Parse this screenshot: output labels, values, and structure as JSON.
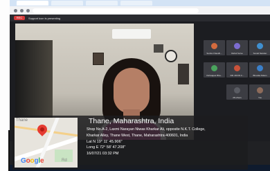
{
  "browser": {
    "tabs": [
      "",
      "",
      "",
      ""
    ],
    "meet_status": "Support icon is presenting",
    "rec_label": "REC"
  },
  "speaker": {
    "name_tag": "Dr.Pritty Bhatia"
  },
  "participants": [
    {
      "name": "Sunita Chaudh...",
      "color": "#d36b3e"
    },
    {
      "name": "Rahul Surve",
      "color": "#7c6cd0"
    },
    {
      "name": "Sonali Nandan",
      "color": "#3f8fd0"
    },
    {
      "name": "Vishwajeet Bha...",
      "color": "#4aa35d"
    },
    {
      "name": "DR. ARUN C...",
      "color": "#c9523a"
    },
    {
      "name": "Bhuvika Nikam",
      "color": "#3a7fc9"
    },
    {
      "name": "28 others",
      "color": "#5a5c63"
    },
    {
      "name": "You",
      "color": "#8d6b5a"
    }
  ],
  "geotag": {
    "title": "Thane, Maharashtra, India",
    "address_line1": "Shop No.A-2, Laxmi Narayan Niwas Kharkar Ali, opposite N.K.T. College,",
    "address_line2": "Kharkar Alley, Thane West, Thane, Maharashtra 400601, India",
    "lat": "Lat N 19° 11' 45.906\"",
    "long": "Long E 72° 58' 47.208\"",
    "datetime": "16/07/21 03:32 PM",
    "map_place_label": "Thane",
    "map_road_label": "Rd",
    "map_brand": [
      "G",
      "o",
      "o",
      "g",
      "l",
      "e"
    ]
  },
  "colors": {
    "pin": "#e53b31",
    "rec": "#d63b3b",
    "overlay": "#1c1c1e"
  }
}
